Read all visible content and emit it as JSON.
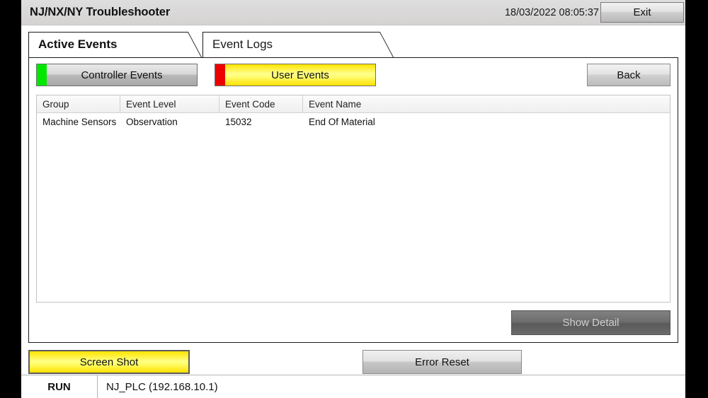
{
  "window": {
    "title": "NJ/NX/NY Troubleshooter",
    "clock": "18/03/2022 08:05:37",
    "exit_label": "Exit"
  },
  "tabs": [
    {
      "name": "active-events",
      "label": "Active Events",
      "active": true
    },
    {
      "name": "event-logs",
      "label": "Event Logs",
      "active": false
    }
  ],
  "source_selector": {
    "controller_events": {
      "label": "Controller Events",
      "led_color": "#00e800",
      "selected": false
    },
    "user_events": {
      "label": "User Events",
      "led_color": "#ed0000",
      "selected": true
    },
    "back_label": "Back"
  },
  "table": {
    "columns": [
      "Group",
      "Event Level",
      "Event Code",
      "Event Name"
    ],
    "rows": [
      {
        "group": "Machine Sensors",
        "level": "Observation",
        "code": "15032",
        "event_name": "End Of Material"
      }
    ]
  },
  "detail": {
    "show_detail_label": "Show Detail",
    "enabled": false
  },
  "actions": {
    "screen_shot_label": "Screen Shot",
    "error_reset_label": "Error Reset"
  },
  "status_bar": {
    "mode": "RUN",
    "device": "NJ_PLC (192.168.10.1)"
  },
  "colors": {
    "accent_yellow": "#ffff00",
    "led_green": "#00e800",
    "led_red": "#ed0000",
    "title_bar": "#d5d2d2"
  }
}
